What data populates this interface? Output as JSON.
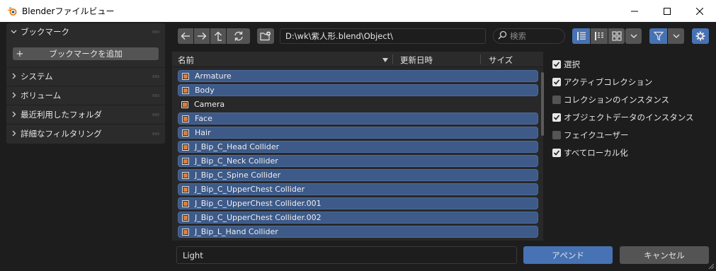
{
  "window": {
    "title": "Blenderファイルビュー"
  },
  "sidebar": {
    "bookmarks_label": "ブックマーク",
    "add_bookmark_label": "ブックマークを追加",
    "sections": [
      {
        "label": "システム"
      },
      {
        "label": "ボリューム"
      },
      {
        "label": "最近利用したフォルダ"
      },
      {
        "label": "詳細なフィルタリング"
      }
    ]
  },
  "toolbar": {
    "path": "D:\\wk\\紫人形.blend\\Object\\",
    "search_placeholder": "検索"
  },
  "list": {
    "columns": {
      "name": "名前",
      "modified": "更新日時",
      "size": "サイズ"
    },
    "rows": [
      {
        "name": "Armature",
        "selected": true
      },
      {
        "name": "Body",
        "selected": true
      },
      {
        "name": "Camera",
        "selected": false
      },
      {
        "name": "Face",
        "selected": true
      },
      {
        "name": "Hair",
        "selected": true
      },
      {
        "name": "J_Bip_C_Head Collider",
        "selected": true
      },
      {
        "name": "J_Bip_C_Neck Collider",
        "selected": true
      },
      {
        "name": "J_Bip_C_Spine Collider",
        "selected": true
      },
      {
        "name": "J_Bip_C_UpperChest Collider",
        "selected": true
      },
      {
        "name": "J_Bip_C_UpperChest Collider.001",
        "selected": true
      },
      {
        "name": "J_Bip_C_UpperChest Collider.002",
        "selected": true
      },
      {
        "name": "J_Bip_L_Hand Collider",
        "selected": true
      }
    ]
  },
  "options": [
    {
      "label": "選択",
      "checked": true
    },
    {
      "label": "アクティブコレクション",
      "checked": true
    },
    {
      "label": "コレクションのインスタンス",
      "checked": false
    },
    {
      "label": "オブジェクトデータのインスタンス",
      "checked": true
    },
    {
      "label": "フェイクユーザー",
      "checked": false
    },
    {
      "label": "すべてローカル化",
      "checked": true
    }
  ],
  "bottom": {
    "filename": "Light",
    "append_label": "アペンド",
    "cancel_label": "キャンセル"
  },
  "colors": {
    "accent": "#4772b3",
    "selected_row": "#3d5a89",
    "panel": "#2b2b2b",
    "background": "#1d1d1d"
  }
}
